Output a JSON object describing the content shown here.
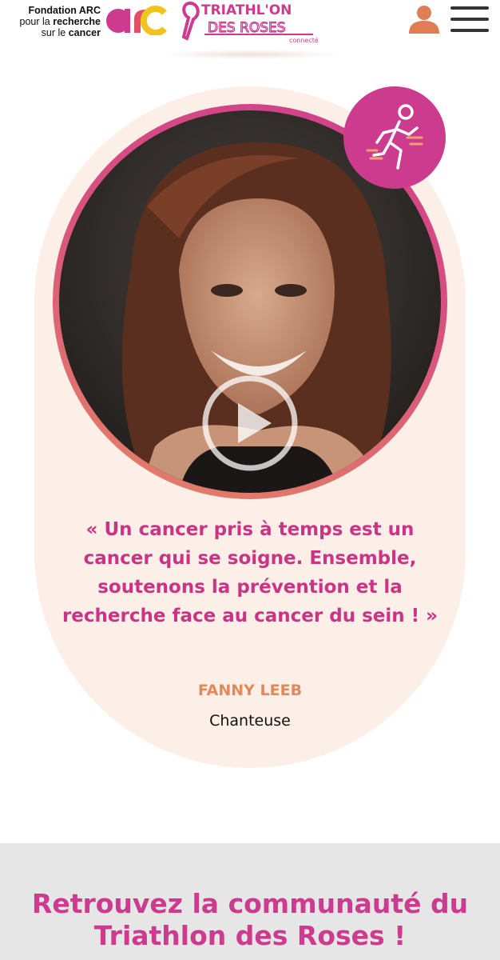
{
  "header": {
    "arc_line1": "Fondation ARC",
    "arc_line2_pre": "pour la ",
    "arc_line2_bold": "recherche",
    "arc_line3_pre": "sur le ",
    "arc_line3_bold": "cancer",
    "arc_logo_text": "arc",
    "triathlon_line1": "TRIATHL'ON",
    "triathlon_line2": "DES ROSES",
    "triathlon_tag": "connecté",
    "user_icon": "user-icon",
    "menu_icon": "hamburger-menu-icon"
  },
  "testimonial": {
    "quote": "« Un cancer pris à temps est un cancer qui se soigne. Ensemble, soutenons la prévention et la recherche face au cancer du sein ! »",
    "name": "FANNY LEEB",
    "role": "Chanteuse",
    "badge_icon": "running-stairs-icon",
    "play_icon": "play-icon"
  },
  "community": {
    "title": "Retrouvez la communauté du Triathlon des Roses !"
  },
  "colors": {
    "brand_pink": "#cc3b8d",
    "accent_orange": "#e08a5c",
    "card_bg": "#fbefe8"
  }
}
